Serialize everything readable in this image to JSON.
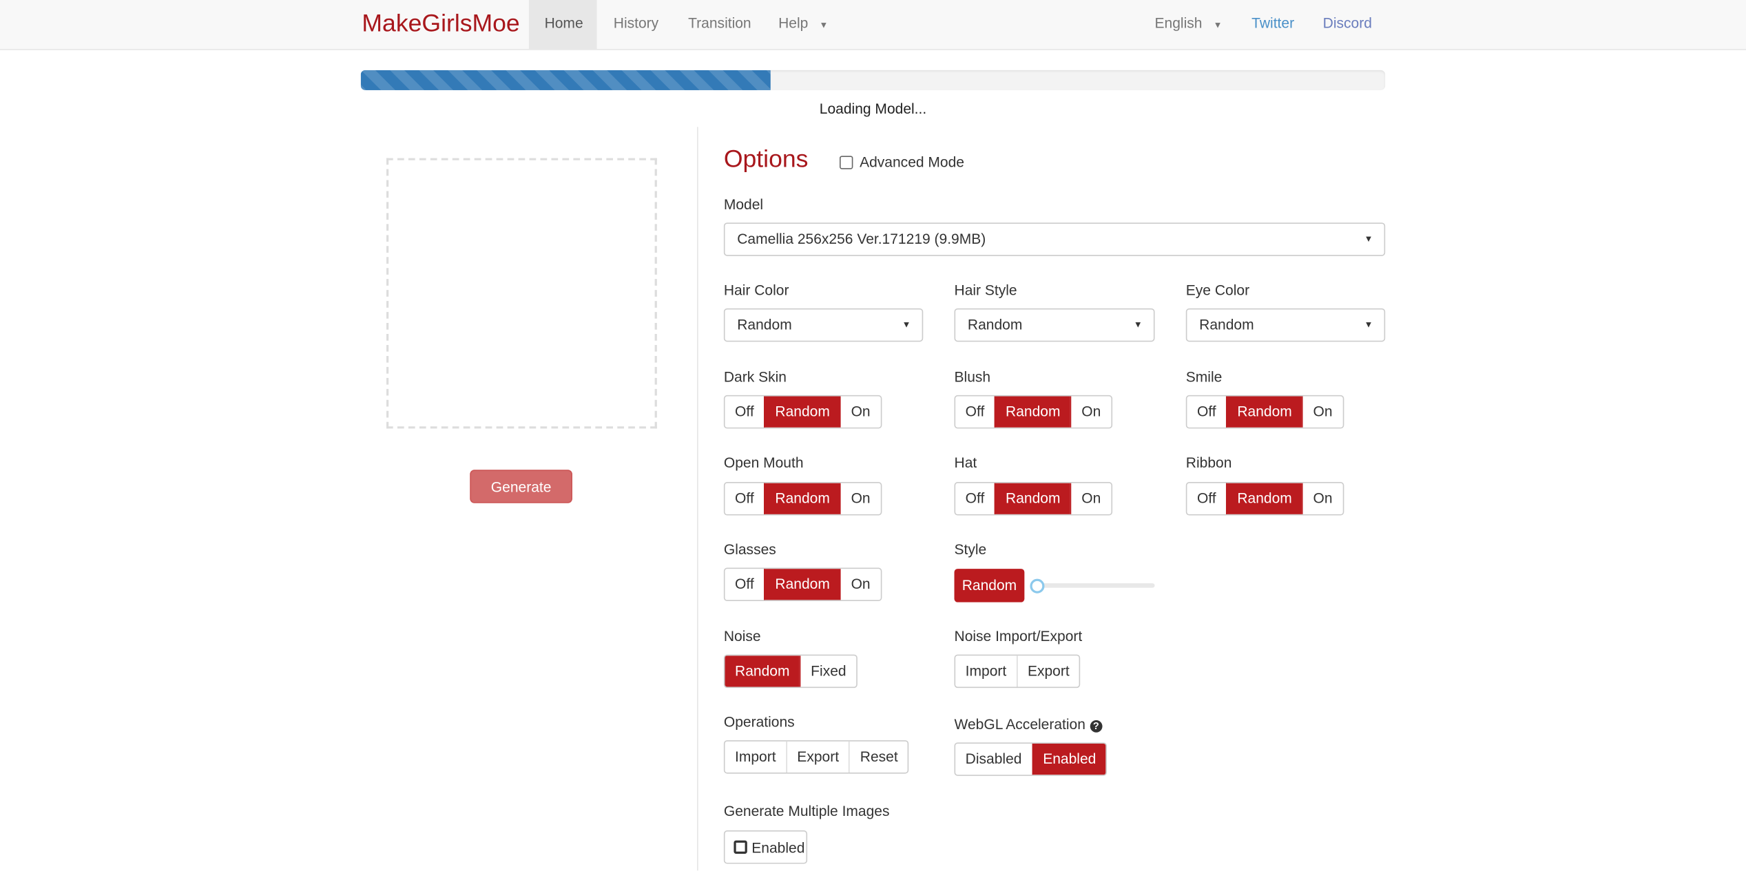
{
  "nav": {
    "brand": "MakeGirlsMoe",
    "items": [
      {
        "label": "Home",
        "active": true
      },
      {
        "label": "History"
      },
      {
        "label": "Transition"
      },
      {
        "label": "Help"
      }
    ],
    "language": "English",
    "twitter": "Twitter",
    "discord": "Discord"
  },
  "progress": {
    "percent": 40,
    "text": "Loading Model..."
  },
  "left": {
    "generate": "Generate"
  },
  "options": {
    "title": "Options",
    "advanced_mode": "Advanced Mode",
    "model_label": "Model",
    "model_value": "Camellia 256x256 Ver.171219 (9.9MB)",
    "hair_color": {
      "label": "Hair Color",
      "value": "Random"
    },
    "hair_style": {
      "label": "Hair Style",
      "value": "Random"
    },
    "eye_color": {
      "label": "Eye Color",
      "value": "Random"
    },
    "toggles": {
      "off": "Off",
      "random": "Random",
      "on": "On",
      "dark_skin": "Dark Skin",
      "blush": "Blush",
      "smile": "Smile",
      "open_mouth": "Open Mouth",
      "hat": "Hat",
      "ribbon": "Ribbon",
      "glasses": "Glasses"
    },
    "style": {
      "label": "Style",
      "button": "Random",
      "slider_value": 0
    },
    "noise": {
      "label": "Noise",
      "random": "Random",
      "fixed": "Fixed"
    },
    "noise_io": {
      "label": "Noise Import/Export",
      "import": "Import",
      "export": "Export"
    },
    "operations": {
      "label": "Operations",
      "import": "Import",
      "export": "Export",
      "reset": "Reset"
    },
    "webgl": {
      "label": "WebGL Acceleration",
      "disabled": "Disabled",
      "enabled": "Enabled"
    },
    "multi": {
      "label": "Generate Multiple Images",
      "enabled": "Enabled"
    }
  },
  "colors": {
    "accent": "#bb1b1f",
    "progress": "#337ab7"
  }
}
